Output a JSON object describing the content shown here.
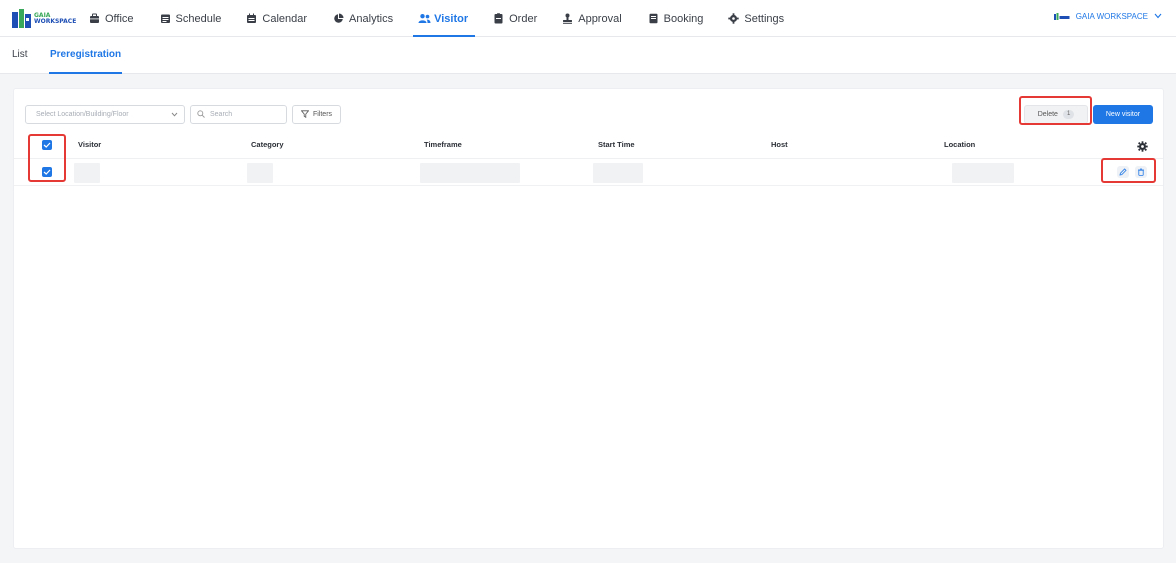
{
  "brand": {
    "logo_top": "GAIA",
    "logo_bottom": "WORKSPACE",
    "accent": "#1f77e6",
    "highlight": "#e53935"
  },
  "nav": {
    "items": [
      {
        "label": "Office",
        "icon": "briefcase-icon"
      },
      {
        "label": "Schedule",
        "icon": "schedule-icon"
      },
      {
        "label": "Calendar",
        "icon": "calendar-icon"
      },
      {
        "label": "Analytics",
        "icon": "pie-chart-icon"
      },
      {
        "label": "Visitor",
        "icon": "users-icon",
        "active": true
      },
      {
        "label": "Order",
        "icon": "clipboard-icon"
      },
      {
        "label": "Approval",
        "icon": "stamp-icon"
      },
      {
        "label": "Booking",
        "icon": "book-icon"
      },
      {
        "label": "Settings",
        "icon": "gear-icon"
      }
    ],
    "workspace": "GAIA WORKSPACE"
  },
  "tabs": [
    {
      "label": "List"
    },
    {
      "label": "Preregistration",
      "active": true
    }
  ],
  "toolbar": {
    "location_placeholder": "Select Location/Building/Floor",
    "search_placeholder": "Search",
    "filters_label": "Filters",
    "delete_label": "Delete",
    "delete_count": "1",
    "new_visitor_label": "New visitor"
  },
  "table": {
    "columns": [
      "Visitor",
      "Category",
      "Timeframe",
      "Start Time",
      "Host",
      "Location"
    ],
    "header_checked": true,
    "rows": [
      {
        "checked": true
      }
    ]
  }
}
